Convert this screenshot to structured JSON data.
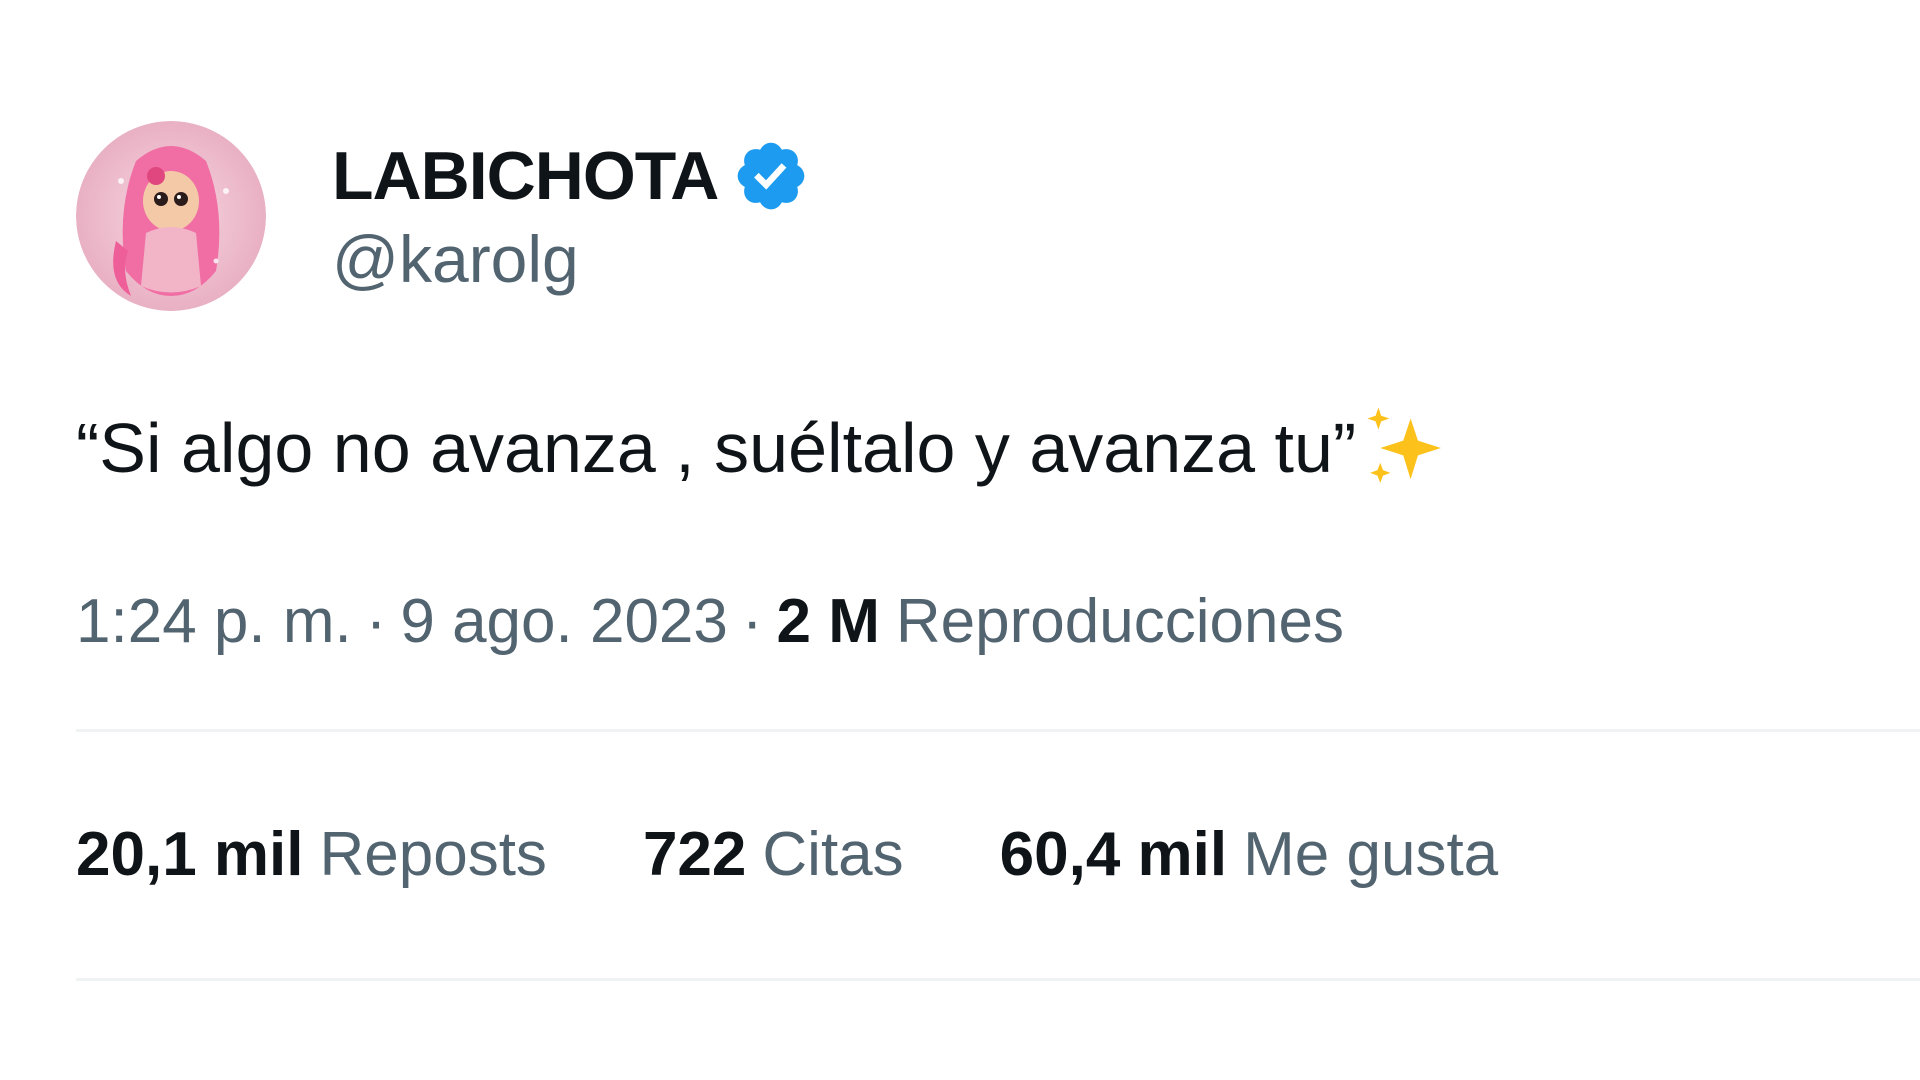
{
  "author": {
    "display_name": "LABICHOTA",
    "handle": "@karolg",
    "verified_icon": "verified-badge-icon",
    "avatar_icon": "avatar-pink-hair-illustration",
    "verified_color": "#1d9bf0"
  },
  "tweet": {
    "text": "“Si algo no avanza , suéltalo y avanza tu”",
    "emoji_icon": "sparkles-icon"
  },
  "meta": {
    "time": "1:24 p. m.",
    "separator": "·",
    "date": "9 ago. 2023",
    "views_count": "2 M",
    "views_label": "Reproducciones"
  },
  "stats": {
    "reposts_count": "20,1 mil",
    "reposts_label": "Reposts",
    "quotes_count": "722",
    "quotes_label": "Citas",
    "likes_count": "60,4 mil",
    "likes_label": "Me gusta"
  },
  "colors": {
    "text_primary": "#0f1419",
    "text_secondary": "#536471",
    "divider": "#eff3f4",
    "accent": "#1d9bf0"
  }
}
